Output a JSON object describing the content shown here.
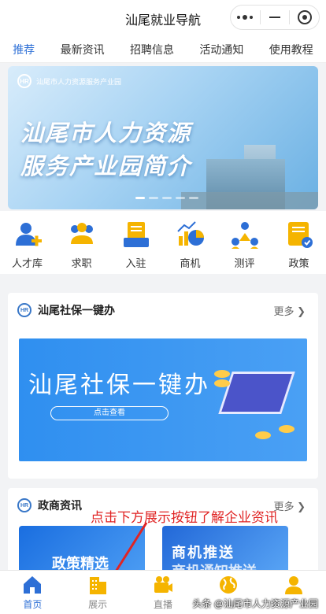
{
  "app": {
    "title": "汕尾就业导航"
  },
  "tabs": [
    "推荐",
    "最新资讯",
    "招聘信息",
    "活动通知",
    "使用教程"
  ],
  "banner": {
    "org_name": "汕尾市人力资源服务产业园",
    "line1": "汕尾市人力资源",
    "line2": "服务产业园简介"
  },
  "quick_links": [
    "人才库",
    "求职",
    "入驻",
    "商机",
    "测评",
    "政策"
  ],
  "social_section": {
    "title": "汕尾社保一键办",
    "more": "更多",
    "banner_title": "汕尾社保一键办",
    "banner_button": "点击查看"
  },
  "gov_section": {
    "title": "政商资讯",
    "more": "更多",
    "card1": "政策精选",
    "card2_line1": "商机推送",
    "card2_line2": "商机通知推送"
  },
  "annotation": "点击下方展示按钮了解企业资讯",
  "bottom_nav": [
    "首页",
    "展示",
    "直播",
    "",
    ""
  ],
  "watermark": "头条 @汕尾市人力资源产业园",
  "colors": {
    "accent": "#2d6fd6",
    "icon_yellow": "#f5b400",
    "annotation": "#e02424"
  }
}
